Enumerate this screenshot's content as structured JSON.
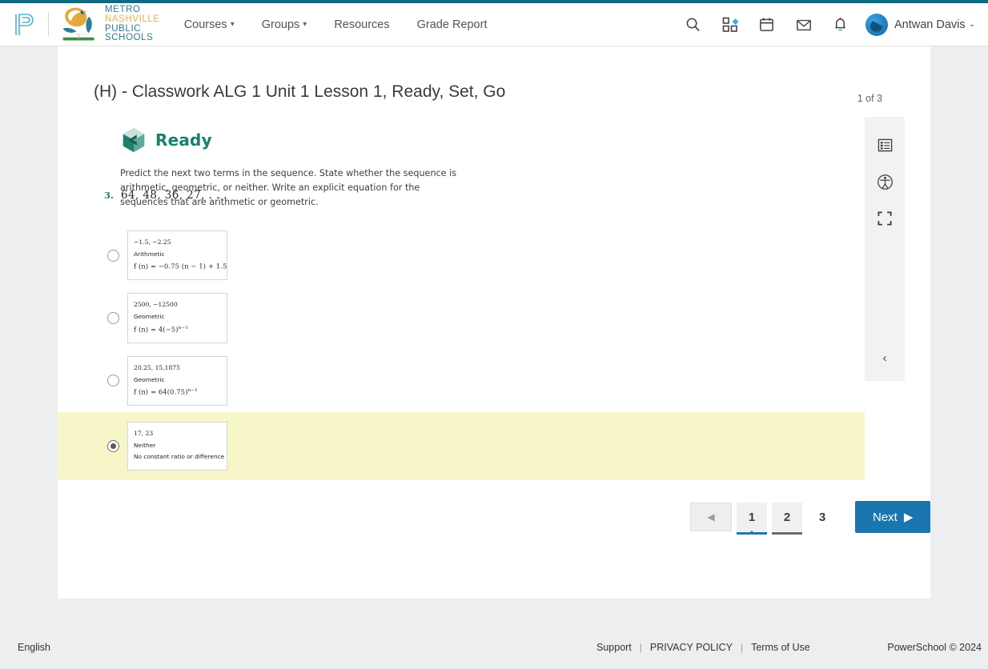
{
  "colors": {
    "top_accent": "#106b80",
    "brand_teal": "#2b7e96",
    "brand_gold": "#e0b44c",
    "ready_green": "#17806e",
    "primary_blue": "#1b76b0",
    "selected_highlight": "#f7f6c8",
    "page_bg": "#eceeef"
  },
  "header": {
    "powerschool_logo": "powerschool-p-logo",
    "district_logo": "mnps-bird-book-logo",
    "district_name_lines": [
      "METRO",
      "NASHVILLE",
      "PUBLIC",
      "SCHOOLS"
    ],
    "nav": [
      {
        "label": "Courses",
        "has_dropdown": true
      },
      {
        "label": "Groups",
        "has_dropdown": true
      },
      {
        "label": "Resources",
        "has_dropdown": false
      },
      {
        "label": "Grade Report",
        "has_dropdown": false
      }
    ],
    "icons": [
      "search-icon",
      "apps-grid-icon",
      "calendar-icon",
      "mail-icon",
      "notification-bell-icon"
    ],
    "user": {
      "name": "Antwan Davis",
      "caret": "⌄"
    }
  },
  "page": {
    "title": "(H) - Classwork ALG 1 Unit 1 Lesson 1, Ready, Set, Go",
    "counter": "1 of 3"
  },
  "rail": {
    "icons": [
      "outline-list-icon",
      "accessibility-icon",
      "fullscreen-icon"
    ],
    "collapse_label": "‹"
  },
  "lesson": {
    "section_icon": "ready-hexagon-icon",
    "section_title": "Ready",
    "instructions": "Predict the next two terms in the sequence. State whether the sequence is arithmetic, geometric, or neither. Write an explicit equation for the sequences that are arithmetic or geometric.",
    "question_number": "3.",
    "question_text": "64, 48, 36, 27, . . .",
    "options": [
      {
        "terms": "−1.5, −2.25",
        "type": "Arithmetic",
        "formula_base": "f (n) = −0.75 (n − 1) + 1.5",
        "formula_exp": "",
        "selected": false
      },
      {
        "terms": "2500, −12500",
        "type": "Geometric",
        "formula_base": "f (n) = 4(−5)",
        "formula_exp": "n−1",
        "selected": false
      },
      {
        "terms": "20.25, 15.1875",
        "type": "Geometric",
        "formula_base": "f (n) = 64(0.75)",
        "formula_exp": "n−1",
        "selected": false
      },
      {
        "terms": "17, 23",
        "type": "Neither",
        "formula_base": "No constant ratio or difference",
        "formula_exp": "",
        "selected": true
      }
    ]
  },
  "pagination": {
    "prev_label": "◀",
    "pages": [
      {
        "label": "1",
        "state": "current"
      },
      {
        "label": "2",
        "state": "visited"
      },
      {
        "label": "3",
        "state": "plain"
      }
    ],
    "next_label": "Next",
    "next_arrow": "▶"
  },
  "footer": {
    "language": "English",
    "links": [
      "Support",
      "PRIVACY POLICY",
      "Terms of Use"
    ],
    "separator": "|",
    "copyright": "PowerSchool © 2024"
  }
}
